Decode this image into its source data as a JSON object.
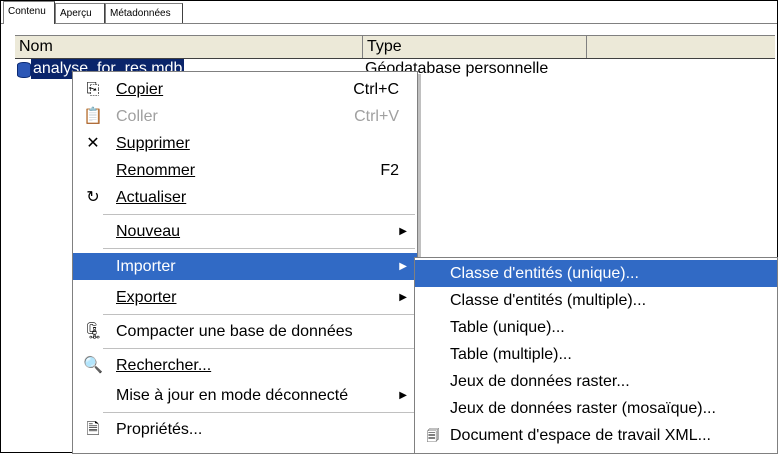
{
  "tabs": [
    {
      "label": "Contenu"
    },
    {
      "label": "Aperçu"
    },
    {
      "label": "Métadonnées"
    }
  ],
  "columns": {
    "name": "Nom",
    "type": "Type"
  },
  "row": {
    "name": "analyse_for_res.mdb",
    "type": "Géodatabase personnelle"
  },
  "context_menu": {
    "copy": {
      "label": "Copier",
      "shortcut": "Ctrl+C"
    },
    "paste": {
      "label": "Coller",
      "shortcut": "Ctrl+V"
    },
    "delete": {
      "label": "Supprimer"
    },
    "rename": {
      "label": "Renommer",
      "shortcut": "F2"
    },
    "refresh": {
      "label": "Actualiser"
    },
    "new": {
      "label": "Nouveau"
    },
    "import": {
      "label": "Importer"
    },
    "export": {
      "label": "Exporter"
    },
    "compact": {
      "label": "Compacter une base de données"
    },
    "search": {
      "label": "Rechercher..."
    },
    "offline": {
      "label": "Mise à jour en mode déconnecté"
    },
    "properties": {
      "label": "Propriétés..."
    }
  },
  "submenu": {
    "feature_class_single": "Classe d'entités (unique)...",
    "feature_class_multiple": "Classe d'entités (multiple)...",
    "table_single": "Table (unique)...",
    "table_multiple": "Table (multiple)...",
    "raster_datasets": "Jeux de données raster...",
    "raster_mosaic": "Jeux de données raster (mosaïque)...",
    "xml_workspace": "Document d'espace de travail XML..."
  },
  "colors": {
    "highlight": "#316ac5",
    "selection": "#0a246a",
    "disabled": "#a0a0a0"
  }
}
